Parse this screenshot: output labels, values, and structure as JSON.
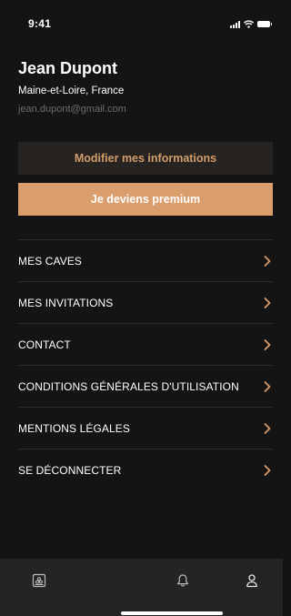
{
  "status_bar": {
    "time": "9:41",
    "icons": [
      "signal-icon",
      "wifi-icon",
      "battery-icon"
    ]
  },
  "profile": {
    "name": "Jean Dupont",
    "location": "Maine-et-Loire, France",
    "email": "jean.dupont@gmail.com"
  },
  "actions": {
    "edit_label": "Modifier mes informations",
    "premium_label": "Je deviens premium"
  },
  "menu": {
    "items": [
      {
        "label": "MES CAVES",
        "icon": "chevron-right-icon"
      },
      {
        "label": "MES INVITATIONS",
        "icon": "chevron-right-icon"
      },
      {
        "label": "CONTACT",
        "icon": "chevron-right-icon"
      },
      {
        "label": "CONDITIONS GÉNÉRALES D'UTILISATION",
        "icon": "chevron-right-icon"
      },
      {
        "label": "MENTIONS LÉGALES",
        "icon": "chevron-right-icon"
      },
      {
        "label": "SE DÉCONNECTER",
        "icon": "chevron-right-icon"
      }
    ]
  },
  "tab_bar": {
    "tabs": [
      {
        "icon": "wine-cellar-icon"
      },
      {
        "icon": "bell-icon"
      },
      {
        "icon": "user-icon"
      }
    ]
  },
  "colors": {
    "background": "#141414",
    "accent": "#d99e6c",
    "accent_text": "#d19d6b",
    "secondary_button": "#262321",
    "muted_text": "#6c6c6c",
    "divider": "#2c2c2c",
    "tab_bar": "#242424"
  }
}
